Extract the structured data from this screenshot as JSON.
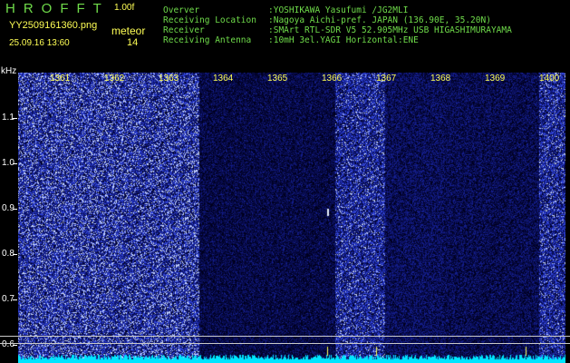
{
  "header": {
    "app_title": "HROFFT",
    "version": "1.00f",
    "filename": "YY2509161360.png",
    "mode": "meteor",
    "datetime": "25.09.16 13:60",
    "count": "14"
  },
  "info": [
    {
      "key": "Overver",
      "value": ":YOSHIKAWA Yasufumi /JG2MLI"
    },
    {
      "key": "Receiving Location",
      "value": ":Nagoya Aichi-pref. JAPAN (136.90E, 35.20N)"
    },
    {
      "key": "Receiver",
      "value": ":SMArt RTL-SDR V5 52.905MHz USB HIGASHIMURAYAMA"
    },
    {
      "key": "Receiving Antenna",
      "value": ":10mH 3el.YAGI Horizontal:ENE"
    }
  ],
  "spectrogram": {
    "freq_unit": "kHz",
    "time_ticks": [
      "1361",
      "1362",
      "1363",
      "1364",
      "1365",
      "1366",
      "1367",
      "1368",
      "1369",
      "1400"
    ],
    "freq_ticks": [
      "1.1",
      "1.0",
      "0.9",
      "0.8",
      "0.7",
      "0.6"
    ],
    "colors": {
      "background_dark": "#000021",
      "noise_blue": "#2a3ad0",
      "noise_bright": "#c8d4ff",
      "baseline_cyan": "#00e5ff",
      "marker_yellow": "#ffff55",
      "label_green": "#6fdc4a"
    }
  }
}
